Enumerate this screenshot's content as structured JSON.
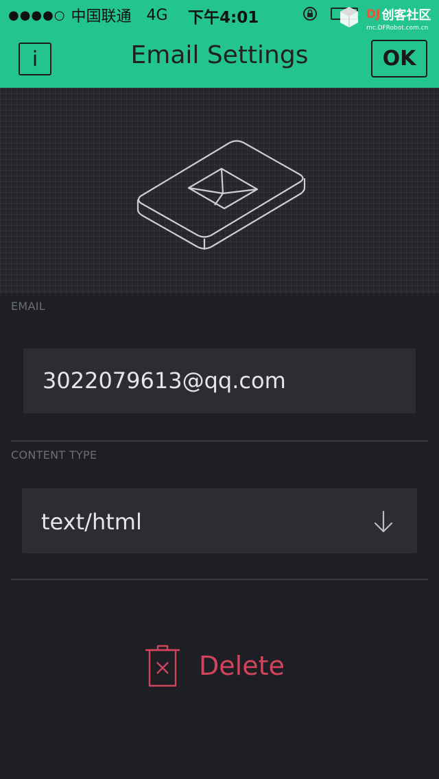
{
  "status_bar": {
    "signal": "●●●●○",
    "carrier": "中国联通",
    "network": "4G",
    "time": "下午4:01",
    "watermark_title": "创客社区",
    "watermark_prefix": "DJ",
    "watermark_url": "mc.DFRobot.com.cn"
  },
  "nav": {
    "info_label": "i",
    "title": "Email Settings",
    "ok_label": "OK"
  },
  "email": {
    "label": "EMAIL",
    "value": "3022079613@qq.com"
  },
  "content_type": {
    "label": "CONTENT TYPE",
    "value": "text/html"
  },
  "actions": {
    "delete_label": "Delete"
  },
  "colors": {
    "accent": "#23c48e",
    "background": "#1e1f24",
    "field": "#2c2d33",
    "danger": "#d3435c"
  },
  "icons": {
    "hero": "email-envelope-icon",
    "dropdown": "arrow-down-icon",
    "delete": "trash-icon"
  }
}
